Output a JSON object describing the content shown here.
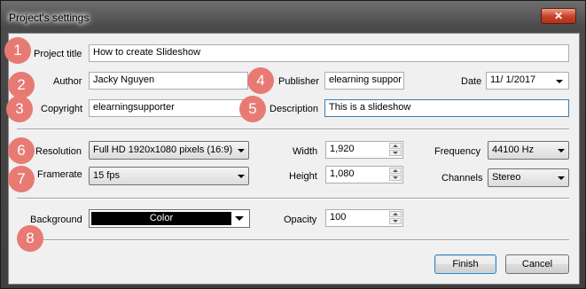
{
  "window": {
    "title": "Project's settings",
    "close_glyph": "✕"
  },
  "form": {
    "project_title": {
      "label": "Project title",
      "value": "How to create Slideshow"
    },
    "author": {
      "label": "Author",
      "value": "Jacky Nguyen"
    },
    "publisher": {
      "label": "Publisher",
      "value": "elearning suppor"
    },
    "date": {
      "label": "Date",
      "value": "11/ 1/2017"
    },
    "copyright": {
      "label": "Copyright",
      "value": "elearningsupporter"
    },
    "description": {
      "label": "Description",
      "value": "This is a slideshow"
    },
    "resolution": {
      "label": "Resolution",
      "value": "Full HD 1920x1080 pixels (16:9)"
    },
    "width": {
      "label": "Width",
      "value": "1,920"
    },
    "frequency": {
      "label": "Frequency",
      "value": "44100 Hz"
    },
    "framerate": {
      "label": "Framerate",
      "value": "15 fps"
    },
    "height": {
      "label": "Height",
      "value": "1,080"
    },
    "channels": {
      "label": "Channels",
      "value": "Stereo"
    },
    "background": {
      "label": "Background",
      "value": "Color",
      "swatch_color": "#000000"
    },
    "opacity": {
      "label": "Opacity",
      "value": "100"
    }
  },
  "buttons": {
    "finish": "Finish",
    "cancel": "Cancel"
  },
  "badges": [
    "1",
    "2",
    "3",
    "4",
    "5",
    "6",
    "7",
    "8"
  ],
  "colors": {
    "badge": "#e87a74",
    "focus_border": "#3c7fb1",
    "close": "#c7452b"
  }
}
